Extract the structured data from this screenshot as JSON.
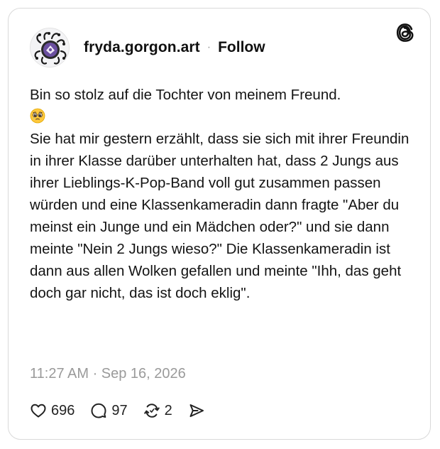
{
  "post": {
    "username": "fryda.gorgon.art",
    "separator": "·",
    "follow_label": "Follow",
    "text_line_1": "Bin so stolz auf die Tochter von meinem Freund.",
    "emoji": "🥹",
    "text_body": "Sie hat mir gestern erzählt, dass sie sich mit ihrer Freundin in ihrer Klasse darüber unterhalten hat, dass 2 Jungs aus ihrer Lieblings-K-Pop-Band voll gut zusammen passen würden und eine Klassenkameradin dann fragte \"Aber du meinst ein Junge und ein Mädchen oder?\" und sie dann meinte \"Nein 2 Jungs wieso?\" Die Klassenkameradin ist dann aus allen Wolken gefallen und meinte \"Ihh, das geht doch gar nicht, das ist doch eklig\".",
    "timestamp": "11:27 AM · Sep 16, 2026"
  },
  "actions": {
    "likes": "696",
    "replies": "97",
    "reposts": "2"
  },
  "icons": {
    "logo": "threads-logo-icon",
    "like": "heart-icon",
    "reply": "comment-bubble-icon",
    "repost": "repost-arrows-icon",
    "share": "send-icon"
  },
  "colors": {
    "text": "#111111",
    "muted": "#9a9a9a",
    "border": "#d9d9d9",
    "avatar_accent": "#6b4fa0"
  }
}
